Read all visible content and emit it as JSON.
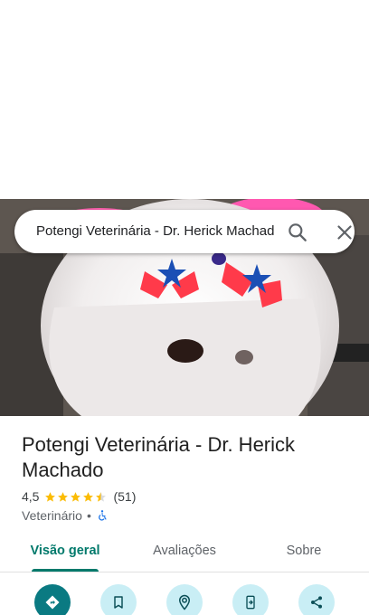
{
  "search": {
    "query": "Potengi Veterinária - Dr. Herick Machado"
  },
  "place": {
    "title": "Potengi Veterinária - Dr. Herick Machado",
    "rating": "4,5",
    "rating_stars": 4.5,
    "review_count": "(51)",
    "category": "Veterinário",
    "separator": "•",
    "accessibility_icon": "wheelchair-icon"
  },
  "tabs": [
    {
      "label": "Visão geral",
      "active": true
    },
    {
      "label": "Avaliações",
      "active": false
    },
    {
      "label": "Sobre",
      "active": false
    }
  ],
  "actions": [
    {
      "icon": "directions-icon",
      "primary": true
    },
    {
      "icon": "bookmark-icon",
      "primary": false
    },
    {
      "icon": "nearby-icon",
      "primary": false
    },
    {
      "icon": "send-to-phone-icon",
      "primary": false
    },
    {
      "icon": "share-icon",
      "primary": false
    }
  ],
  "colors": {
    "accent": "#00796b",
    "action_primary": "#0a7a82",
    "action_secondary": "#c9eef5",
    "star": "#fbbc04",
    "accessibility_blue": "#1a73e8"
  }
}
